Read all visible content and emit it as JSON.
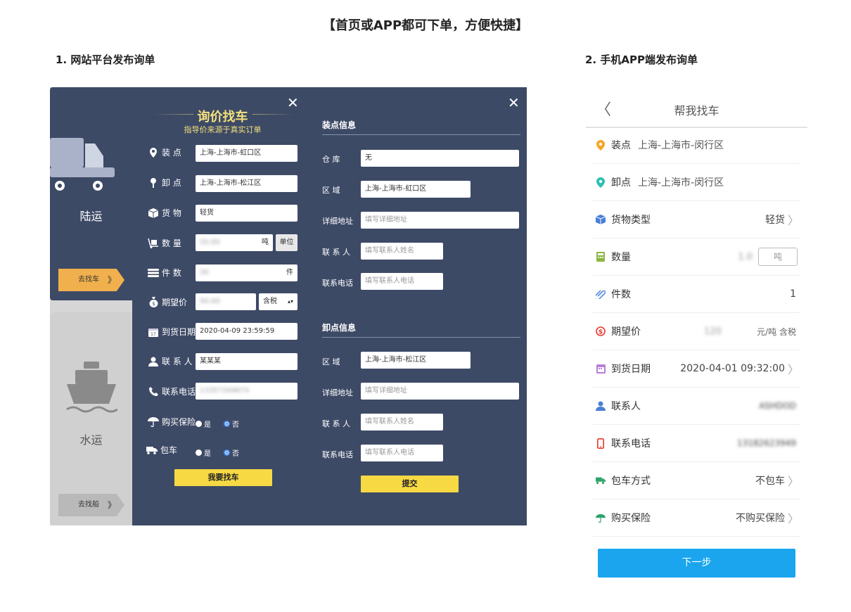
{
  "page_title": "【首页或APP都可下单，方便快捷】",
  "section_web_title": "1. 网站平台发布询单",
  "section_app_title": "2. 手机APP端发布询单",
  "web": {
    "land_tab": {
      "label": "陆运",
      "button": "去找车",
      "arrow": "》"
    },
    "water_tab": {
      "label": "水运",
      "button": "去找船",
      "arrow": "》"
    },
    "close_symbol": "✕",
    "form": {
      "title": "询价找车",
      "subtitle": "指导价来源于真实订单",
      "load_label": "装 点",
      "load_value": "上海-上海市-虹口区",
      "unload_label": "卸 点",
      "unload_value": "上海-上海市-松江区",
      "goods_label": "货 物",
      "goods_value": "轻货",
      "qty_label": "数 量",
      "qty_value": "20.00",
      "qty_unit": "吨",
      "qty_unit_btn": "单位",
      "pieces_label": "件 数",
      "pieces_value": "30",
      "pieces_unit": "件",
      "price_label": "期望价",
      "price_value": "50.00",
      "tax_select": "含税",
      "date_label": "到货日期",
      "date_value": "2020-04-09 23:59:59",
      "contact_label": "联 系 人",
      "contact_value": "某某某",
      "phone_label": "联系电话",
      "phone_value": "13357349874",
      "insurance_label": "购买保险",
      "yes": "是",
      "no": "否",
      "charter_label": "包车",
      "submit": "我要找车"
    },
    "loading_info": {
      "header": "装点信息",
      "warehouse_label": "仓 库",
      "warehouse_value": "无",
      "area_label": "区 域",
      "area_value": "上海-上海市-虹口区",
      "address_label": "详细地址",
      "address_placeholder": "填写详细地址",
      "contact_label": "联 系 人",
      "contact_placeholder": "填写联系人姓名",
      "phone_label": "联系电话",
      "phone_placeholder": "填写联系人电话"
    },
    "unloading_info": {
      "header": "卸点信息",
      "area_label": "区 域",
      "area_value": "上海-上海市-松江区",
      "address_label": "详细地址",
      "address_placeholder": "填写详细地址",
      "contact_label": "联 系 人",
      "contact_placeholder": "填写联系人姓名",
      "phone_label": "联系电话",
      "phone_placeholder": "填写联系人电话",
      "submit": "提交"
    }
  },
  "app": {
    "back": "〈",
    "title": "帮我找车",
    "rows": {
      "load": {
        "label": "装点",
        "value": "上海-上海市-闵行区"
      },
      "unload": {
        "label": "卸点",
        "value": "上海-上海市-闵行区"
      },
      "goods": {
        "label": "货物类型",
        "value": "轻货"
      },
      "qty": {
        "label": "数量",
        "value": "1.0",
        "unit": "吨"
      },
      "pieces": {
        "label": "件数",
        "value": "1"
      },
      "price": {
        "label": "期望价",
        "value": "120",
        "unit": "元/吨 含税"
      },
      "date": {
        "label": "到货日期",
        "value": "2020-04-01 09:32:00"
      },
      "contact": {
        "label": "联系人",
        "value": "ASHDOD"
      },
      "phone": {
        "label": "联系电话",
        "value": "13182623949"
      },
      "charter": {
        "label": "包车方式",
        "value": "不包车"
      },
      "insurance": {
        "label": "购买保险",
        "value": "不购买保险"
      }
    },
    "chevron": "〉",
    "next_button": "下一步"
  }
}
